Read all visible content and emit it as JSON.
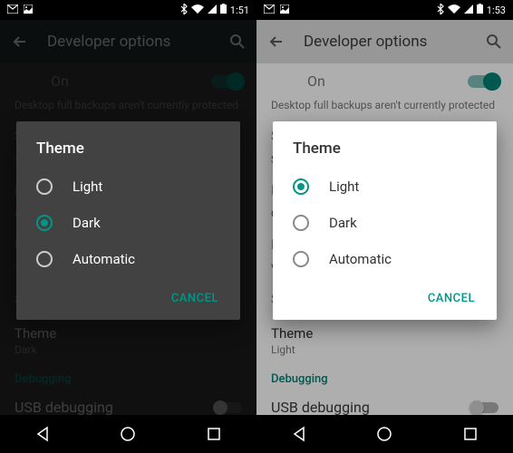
{
  "left": {
    "statusbar": {
      "time": "1:51"
    },
    "appbar": {
      "title": "Developer options"
    },
    "toggle_label": "On",
    "backup_text": "Desktop full backups aren't currently protected",
    "dialog": {
      "title": "Theme",
      "options": {
        "0": "Light",
        "1": "Dark",
        "2": "Automatic"
      },
      "cancel": "CANCEL"
    },
    "theme_label": "Theme",
    "theme_value": "Dark",
    "debugging_header": "Debugging",
    "usb_label": "USB debugging"
  },
  "right": {
    "statusbar": {
      "time": "1:53"
    },
    "appbar": {
      "title": "Developer options"
    },
    "toggle_label": "On",
    "backup_text": "Desktop full backups aren't currently protected",
    "dialog": {
      "title": "Theme",
      "options": {
        "0": "Light",
        "1": "Dark",
        "2": "Automatic"
      },
      "cancel": "CANCEL"
    },
    "theme_label": "Theme",
    "theme_value": "Light",
    "debugging_header": "Debugging",
    "usb_label": "USB debugging"
  }
}
